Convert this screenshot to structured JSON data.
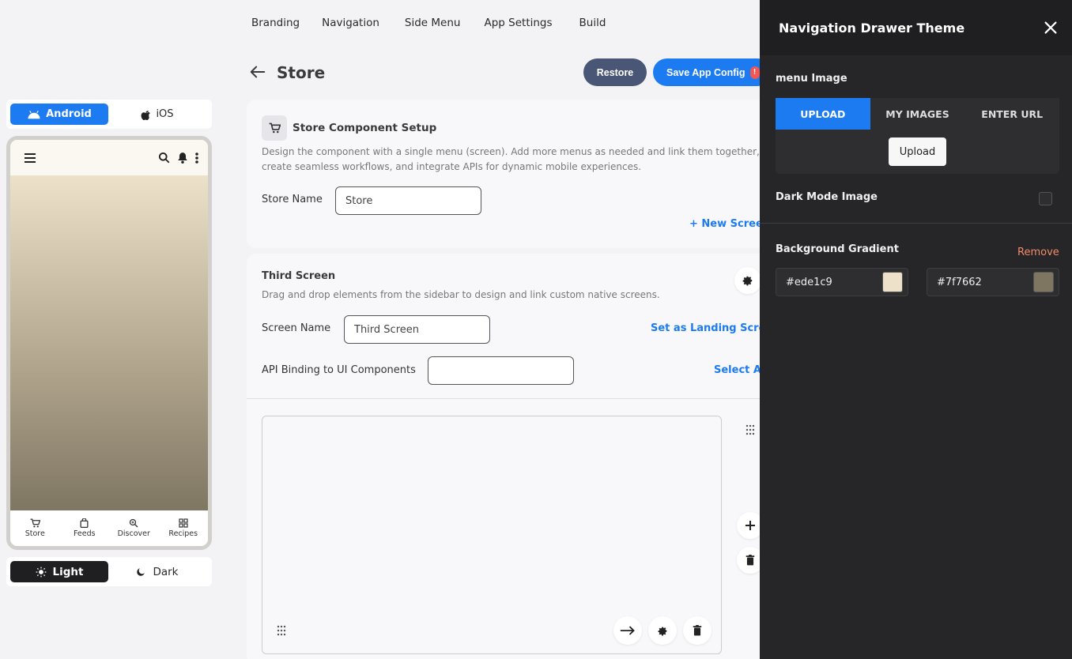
{
  "topnav": [
    "Branding",
    "Navigation",
    "Side Menu",
    "App Settings",
    "Build"
  ],
  "header": {
    "title": "Store",
    "restore_label": "Restore",
    "save_label": "Save App Config",
    "save_badge": "!"
  },
  "platform": {
    "android": "Android",
    "ios": "iOS"
  },
  "phone": {
    "tabs": [
      "Store",
      "Feeds",
      "Discover",
      "Recipes"
    ],
    "gradient_start": "#ede1c9",
    "gradient_end": "#7f7662"
  },
  "theme": {
    "light": "Light",
    "dark": "Dark"
  },
  "store_card": {
    "title": "Store Component Setup",
    "desc1": "Design the component with a single menu (screen). Add more menus as needed and link them together,",
    "desc2": "create seamless workflows, and integrate APIs for dynamic mobile experiences.",
    "name_label": "Store Name",
    "name_value": "Store",
    "new_screen": "+ New Scree"
  },
  "screen_card": {
    "title": "Third Screen",
    "desc": "Drag and drop elements from the sidebar to design and link custom native screens.",
    "name_label": "Screen Name",
    "name_value": "Third Screen",
    "landing_link": "Set as Landing Scree",
    "api_label": "API Binding to UI Components",
    "api_value": "",
    "select_api": "Select AI"
  },
  "drawer": {
    "title": "Navigation Drawer Theme",
    "menu_image_label": "menu Image",
    "tabs": [
      "UPLOAD",
      "MY IMAGES",
      "ENTER URL"
    ],
    "upload_button": "Upload",
    "dark_mode_label": "Dark Mode Image",
    "gradient_label": "Background Gradient",
    "remove_label": "Remove",
    "color1": "#ede1c9",
    "color2": "#7f7662"
  },
  "colors": {
    "accent": "#1d7bf2",
    "restore": "#4a5675",
    "drawer_bg": "#262628",
    "remove": "#f28a6a"
  }
}
